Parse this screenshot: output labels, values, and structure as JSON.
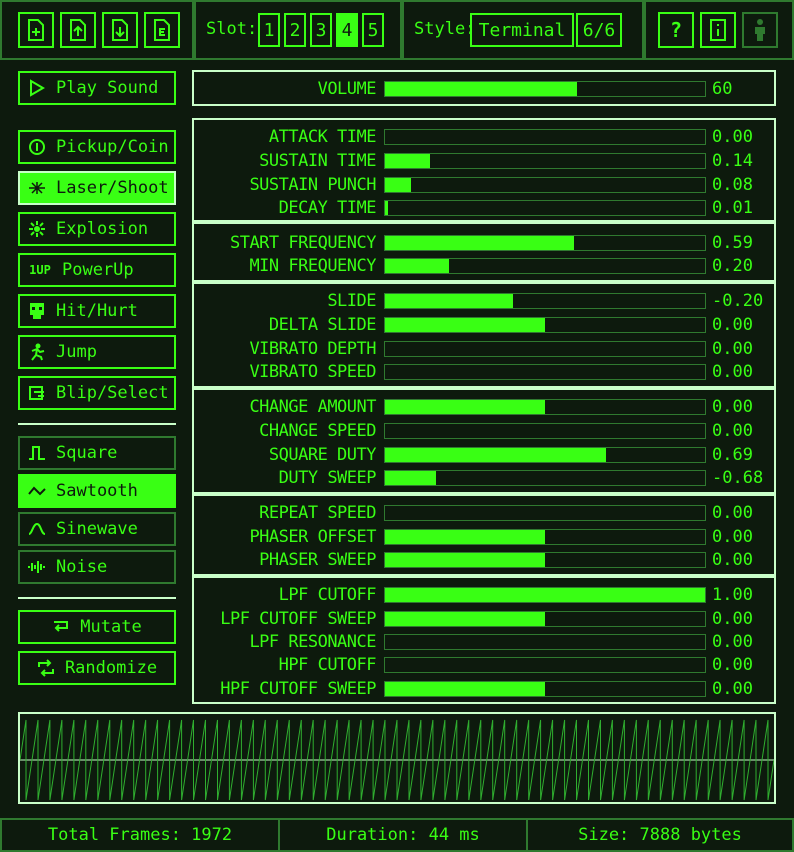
{
  "toolbar": {
    "file_icons": [
      "new-file-icon",
      "upload-icon",
      "download-icon",
      "export-icon"
    ],
    "slot_label": "Slot:",
    "slots": [
      "1",
      "2",
      "3",
      "4",
      "5"
    ],
    "active_slot": "4",
    "style_label": "Style:",
    "style_value": "Terminal",
    "style_count": "6/6",
    "help_label": "?",
    "right_icons": [
      "help-icon",
      "info-icon",
      "figure-icon"
    ]
  },
  "sidebar": {
    "play_label": "Play Sound",
    "presets": [
      {
        "label": "Pickup/Coin",
        "icon": "coin-icon"
      },
      {
        "label": "Laser/Shoot",
        "icon": "laser-icon"
      },
      {
        "label": "Explosion",
        "icon": "explosion-icon"
      },
      {
        "label": "PowerUp",
        "icon": "powerup-icon",
        "glyph": "1UP"
      },
      {
        "label": "Hit/Hurt",
        "icon": "skull-icon"
      },
      {
        "label": "Jump",
        "icon": "jump-icon"
      },
      {
        "label": "Blip/Select",
        "icon": "blip-icon"
      }
    ],
    "active_preset": "Laser/Shoot",
    "waves": [
      {
        "label": "Square",
        "icon": "square-wave-icon"
      },
      {
        "label": "Sawtooth",
        "icon": "sawtooth-wave-icon"
      },
      {
        "label": "Sinewave",
        "icon": "sine-wave-icon"
      },
      {
        "label": "Noise",
        "icon": "noise-wave-icon"
      }
    ],
    "active_wave": "Sawtooth",
    "mutate_label": "Mutate",
    "randomize_label": "Randomize"
  },
  "params": {
    "volume": {
      "label": "VOLUME",
      "value": "60",
      "fill": 0.6
    },
    "groups": [
      [
        {
          "label": "ATTACK TIME",
          "value": "0.00",
          "fill": 0.0
        },
        {
          "label": "SUSTAIN TIME",
          "value": "0.14",
          "fill": 0.14
        },
        {
          "label": "SUSTAIN PUNCH",
          "value": "0.08",
          "fill": 0.08
        },
        {
          "label": "DECAY TIME",
          "value": "0.01",
          "fill": 0.01
        }
      ],
      [
        {
          "label": "START FREQUENCY",
          "value": "0.59",
          "fill": 0.59
        },
        {
          "label": "MIN FREQUENCY",
          "value": "0.20",
          "fill": 0.2
        }
      ],
      [
        {
          "label": "SLIDE",
          "value": "-0.20",
          "fill": 0.4
        },
        {
          "label": "DELTA SLIDE",
          "value": "0.00",
          "fill": 0.5
        },
        {
          "label": "VIBRATO DEPTH",
          "value": "0.00",
          "fill": 0.0
        },
        {
          "label": "VIBRATO SPEED",
          "value": "0.00",
          "fill": 0.0
        }
      ],
      [
        {
          "label": "CHANGE AMOUNT",
          "value": "0.00",
          "fill": 0.5
        },
        {
          "label": "CHANGE SPEED",
          "value": "0.00",
          "fill": 0.0
        },
        {
          "label": "SQUARE DUTY",
          "value": "0.69",
          "fill": 0.69
        },
        {
          "label": "DUTY SWEEP",
          "value": "-0.68",
          "fill": 0.16
        }
      ],
      [
        {
          "label": "REPEAT SPEED",
          "value": "0.00",
          "fill": 0.0
        },
        {
          "label": "PHASER OFFSET",
          "value": "0.00",
          "fill": 0.5
        },
        {
          "label": "PHASER SWEEP",
          "value": "0.00",
          "fill": 0.5
        }
      ],
      [
        {
          "label": "LPF CUTOFF",
          "value": "1.00",
          "fill": 1.0
        },
        {
          "label": "LPF CUTOFF SWEEP",
          "value": "0.00",
          "fill": 0.5
        },
        {
          "label": "LPF RESONANCE",
          "value": "0.00",
          "fill": 0.0
        },
        {
          "label": "HPF CUTOFF",
          "value": "0.00",
          "fill": 0.0
        },
        {
          "label": "HPF CUTOFF SWEEP",
          "value": "0.00",
          "fill": 0.5
        }
      ]
    ]
  },
  "waveform": {
    "cycles": 63
  },
  "status": {
    "frames": "Total Frames: 1972",
    "duration": "Duration: 44 ms",
    "size": "Size: 7888 bytes"
  },
  "colors": {
    "accent": "#39ff14",
    "background": "#0d1a0d",
    "frame": "#2f7a2f",
    "panel_border": "#c8ffc8"
  }
}
